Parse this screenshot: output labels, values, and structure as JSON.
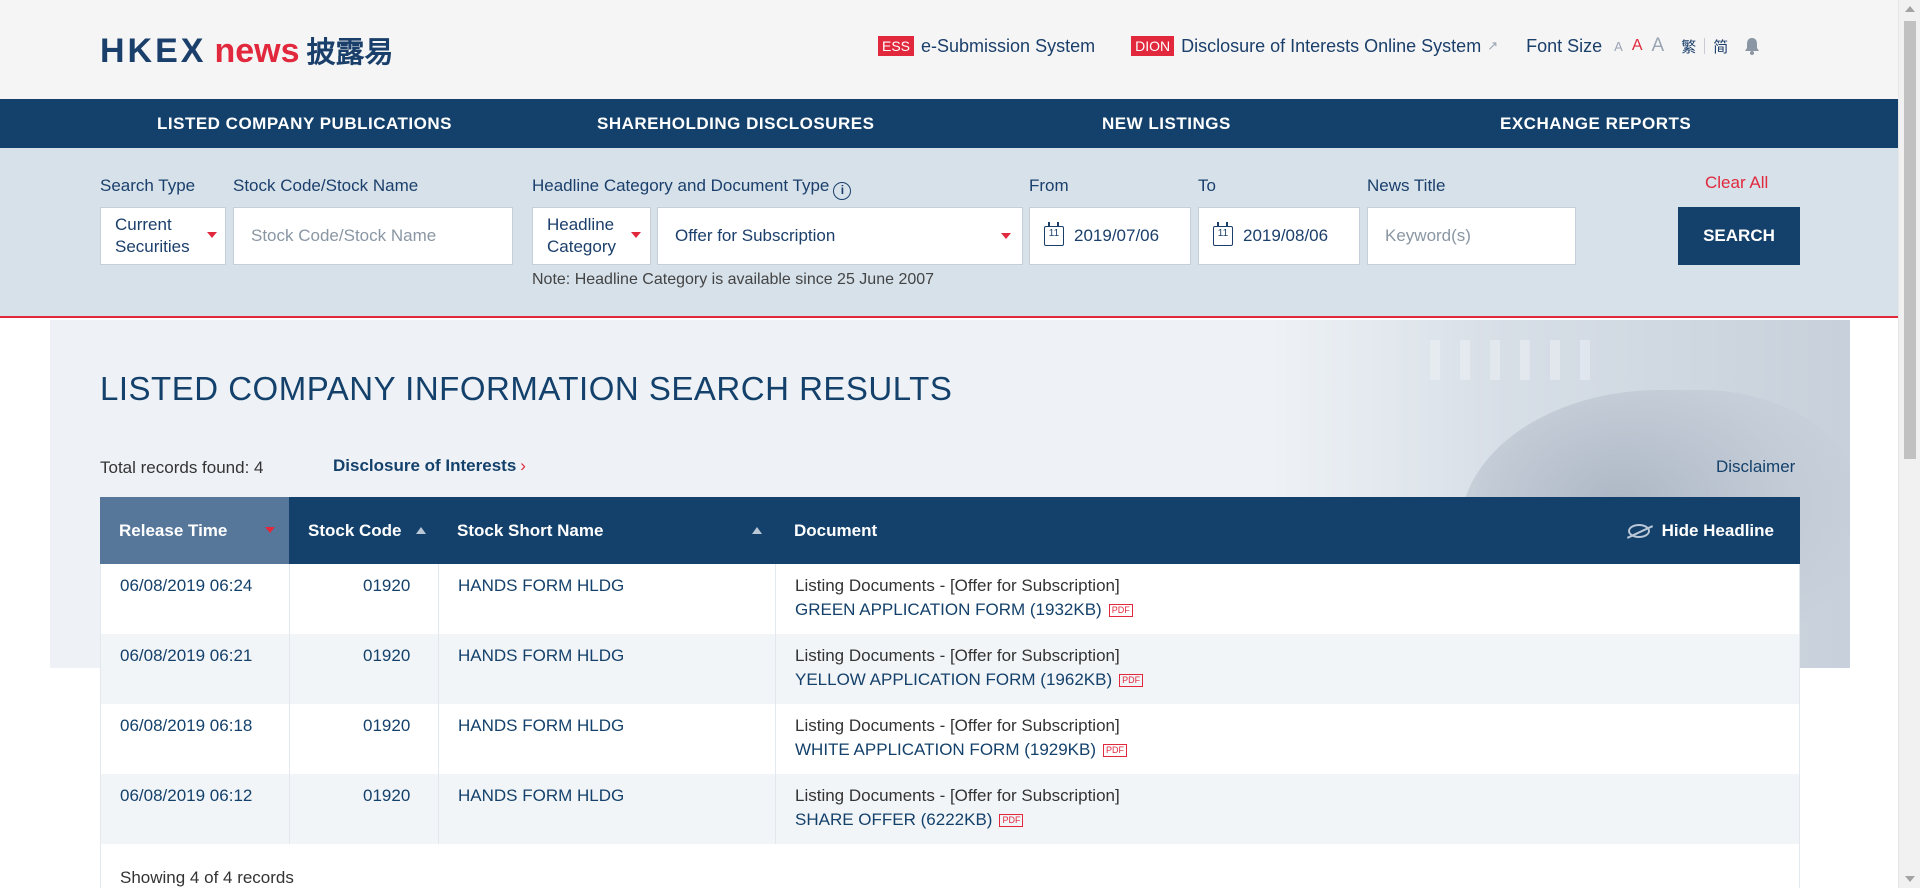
{
  "logo": {
    "hkex": "HKEX",
    "news": "news",
    "chinese": "披露易"
  },
  "top_links": {
    "ess_badge": "ESS",
    "ess_label": "e-Submission System",
    "dion_badge": "DION",
    "dion_label": "Disclosure of Interests Online System",
    "font_size_label": "Font Size",
    "font_a": "A",
    "lang_trad": "繁",
    "lang_simp": "简"
  },
  "nav": {
    "items": [
      "LISTED COMPANY PUBLICATIONS",
      "SHAREHOLDING DISCLOSURES",
      "NEW LISTINGS",
      "EXCHANGE REPORTS"
    ]
  },
  "search": {
    "search_type_label": "Search Type",
    "search_type_value_line1": "Current",
    "search_type_value_line2": "Securities",
    "stock_label": "Stock Code/Stock Name",
    "stock_placeholder": "Stock Code/Stock Name",
    "headline_label": "Headline Category and Document Type",
    "headline_mode_line1": "Headline",
    "headline_mode_line2": "Category",
    "headline_value": "Offer for Subscription",
    "from_label": "From",
    "from_value": "2019/07/06",
    "to_label": "To",
    "to_value": "2019/08/06",
    "news_title_label": "News Title",
    "news_title_placeholder": "Keyword(s)",
    "clear_all": "Clear All",
    "search_button": "SEARCH",
    "note": "Note: Headline Category is available since 25 June 2007",
    "calendar_day": "11"
  },
  "results": {
    "title": "LISTED COMPANY INFORMATION SEARCH RESULTS",
    "total": "Total records found: 4",
    "doi_link": "Disclosure of Interests",
    "disclaimer": "Disclaimer",
    "columns": {
      "release_time": "Release Time",
      "stock_code": "Stock Code",
      "stock_short_name": "Stock Short Name",
      "document": "Document",
      "hide_headline": "Hide Headline"
    },
    "rows": [
      {
        "time": "06/08/2019 06:24",
        "code": "01920",
        "name": "HANDS FORM HLDG",
        "doc_type": "Listing Documents - [Offer for Subscription]",
        "doc_title": "GREEN APPLICATION FORM (1932KB)"
      },
      {
        "time": "06/08/2019 06:21",
        "code": "01920",
        "name": "HANDS FORM HLDG",
        "doc_type": "Listing Documents - [Offer for Subscription]",
        "doc_title": "YELLOW APPLICATION FORM (1962KB)"
      },
      {
        "time": "06/08/2019 06:18",
        "code": "01920",
        "name": "HANDS FORM HLDG",
        "doc_type": "Listing Documents - [Offer for Subscription]",
        "doc_title": "WHITE APPLICATION FORM (1929KB)"
      },
      {
        "time": "06/08/2019 06:12",
        "code": "01920",
        "name": "HANDS FORM HLDG",
        "doc_type": "Listing Documents - [Offer for Subscription]",
        "doc_title": "SHARE OFFER (6222KB)"
      }
    ],
    "pdf_badge": "PDF",
    "showing": "Showing 4 of 4 records"
  },
  "colors": {
    "navy": "#14416b",
    "accent_red": "#e1283c",
    "panel_bg": "#d6e1ea"
  }
}
